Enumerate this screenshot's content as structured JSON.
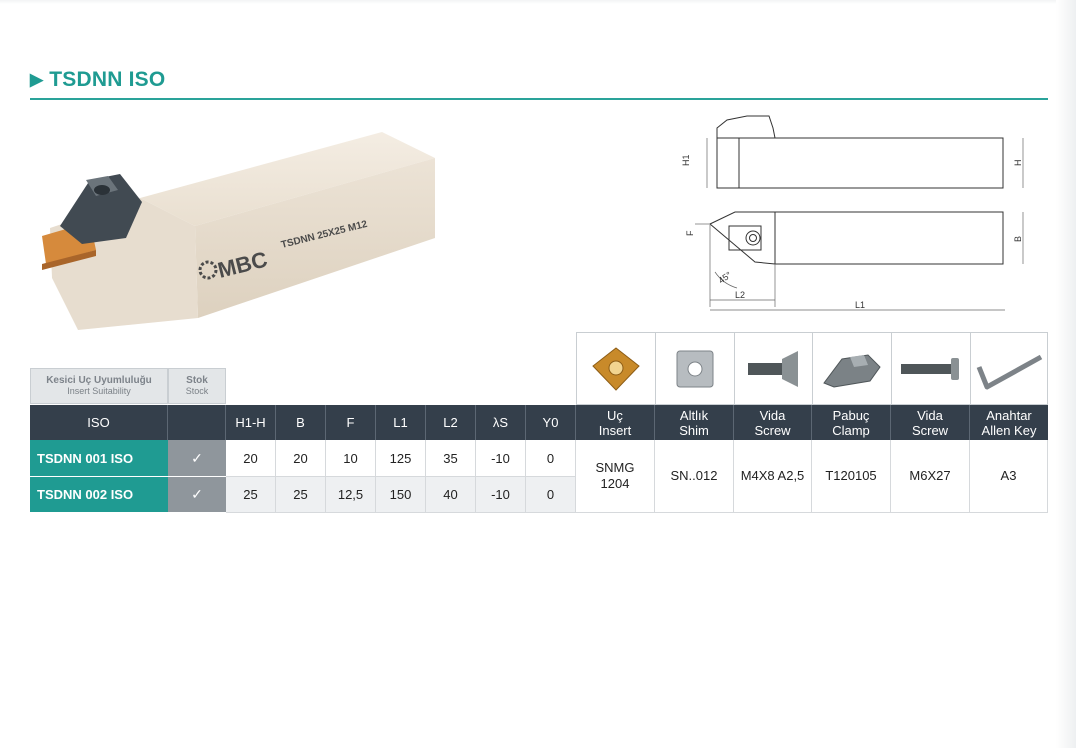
{
  "section": {
    "title": "TSDNN ISO",
    "accent_color": "#1f9b92",
    "header_color": "#343f4b"
  },
  "product_photo": {
    "engraving": "TSDNN 25X25 M12",
    "brand": "MBC"
  },
  "drawing_labels": {
    "h1": "H1",
    "h": "H",
    "f": "F",
    "b": "B",
    "angle": "45°",
    "l2": "L2",
    "l1": "L1"
  },
  "suitability": {
    "tr": "Kesici Uç Uyumluluğu",
    "en": "Insert Suitability"
  },
  "stock_head": {
    "tr": "Stok",
    "en": "Stock"
  },
  "columns": {
    "iso": "ISO",
    "dims": [
      "H1-H",
      "B",
      "F",
      "L1",
      "L2",
      "λS",
      "Y0"
    ],
    "parts": [
      {
        "tr": "Uç",
        "en": "Insert",
        "icon": "insert-icon"
      },
      {
        "tr": "Altlık",
        "en": "Shim",
        "icon": "shim-icon"
      },
      {
        "tr": "Vida",
        "en": "Screw",
        "icon": "screw-icon"
      },
      {
        "tr": "Pabuç",
        "en": "Clamp",
        "icon": "clamp-icon"
      },
      {
        "tr": "Vida",
        "en": "Screw",
        "icon": "screw-long-icon"
      },
      {
        "tr": "Anahtar",
        "en": "Allen Key",
        "icon": "allen-key-icon"
      }
    ]
  },
  "rows": [
    {
      "code": "TSDNN 001 ISO",
      "stock": "✓",
      "dims": [
        "20",
        "20",
        "10",
        "125",
        "35",
        "-10",
        "0"
      ]
    },
    {
      "code": "TSDNN 002 ISO",
      "stock": "✓",
      "dims": [
        "25",
        "25",
        "12,5",
        "150",
        "40",
        "-10",
        "0"
      ]
    }
  ],
  "parts_values": {
    "insert_line1": "SNMG",
    "insert_line2": "1204",
    "shim": "SN..012",
    "screw": "M4X8 A2,5",
    "clamp": "T120105",
    "screw2": "M6X27",
    "key": "A3"
  }
}
